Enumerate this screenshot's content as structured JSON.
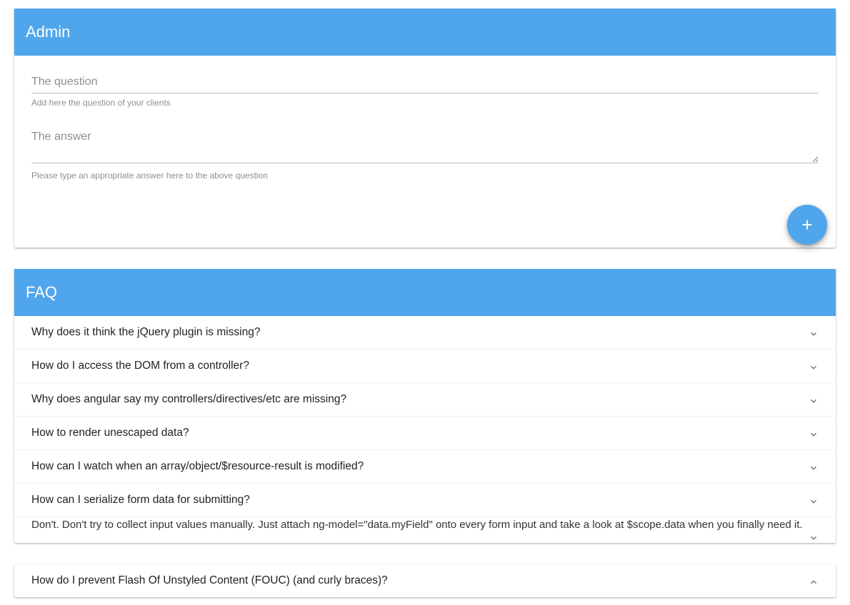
{
  "admin": {
    "title": "Admin",
    "question_placeholder": "The question",
    "question_helper": "Add here the question of your clients",
    "answer_placeholder": "The answer",
    "answer_helper": "Please type an appropriate answer here to the above question",
    "add_label": "+"
  },
  "faq": {
    "title": "FAQ",
    "items": [
      {
        "q": "Why does it think the jQuery plugin is missing?"
      },
      {
        "q": "How do I access the DOM from a controller?"
      },
      {
        "q": "Why does angular say my controllers/directives/etc are missing?"
      },
      {
        "q": "How to render unescaped data?"
      },
      {
        "q": "How can I watch when an array/object/$resource-result is modified?"
      },
      {
        "q": "How can I serialize form data for submitting?"
      },
      {
        "q": "Don't. Don't try to collect input values manually. Just attach ng-model=\"data.myField\" onto every form input and take a look at $scope.data when you finally need it."
      }
    ],
    "extra": {
      "q": "How do I prevent Flash Of Unstyled Content (FOUC) (and curly braces)?"
    }
  }
}
